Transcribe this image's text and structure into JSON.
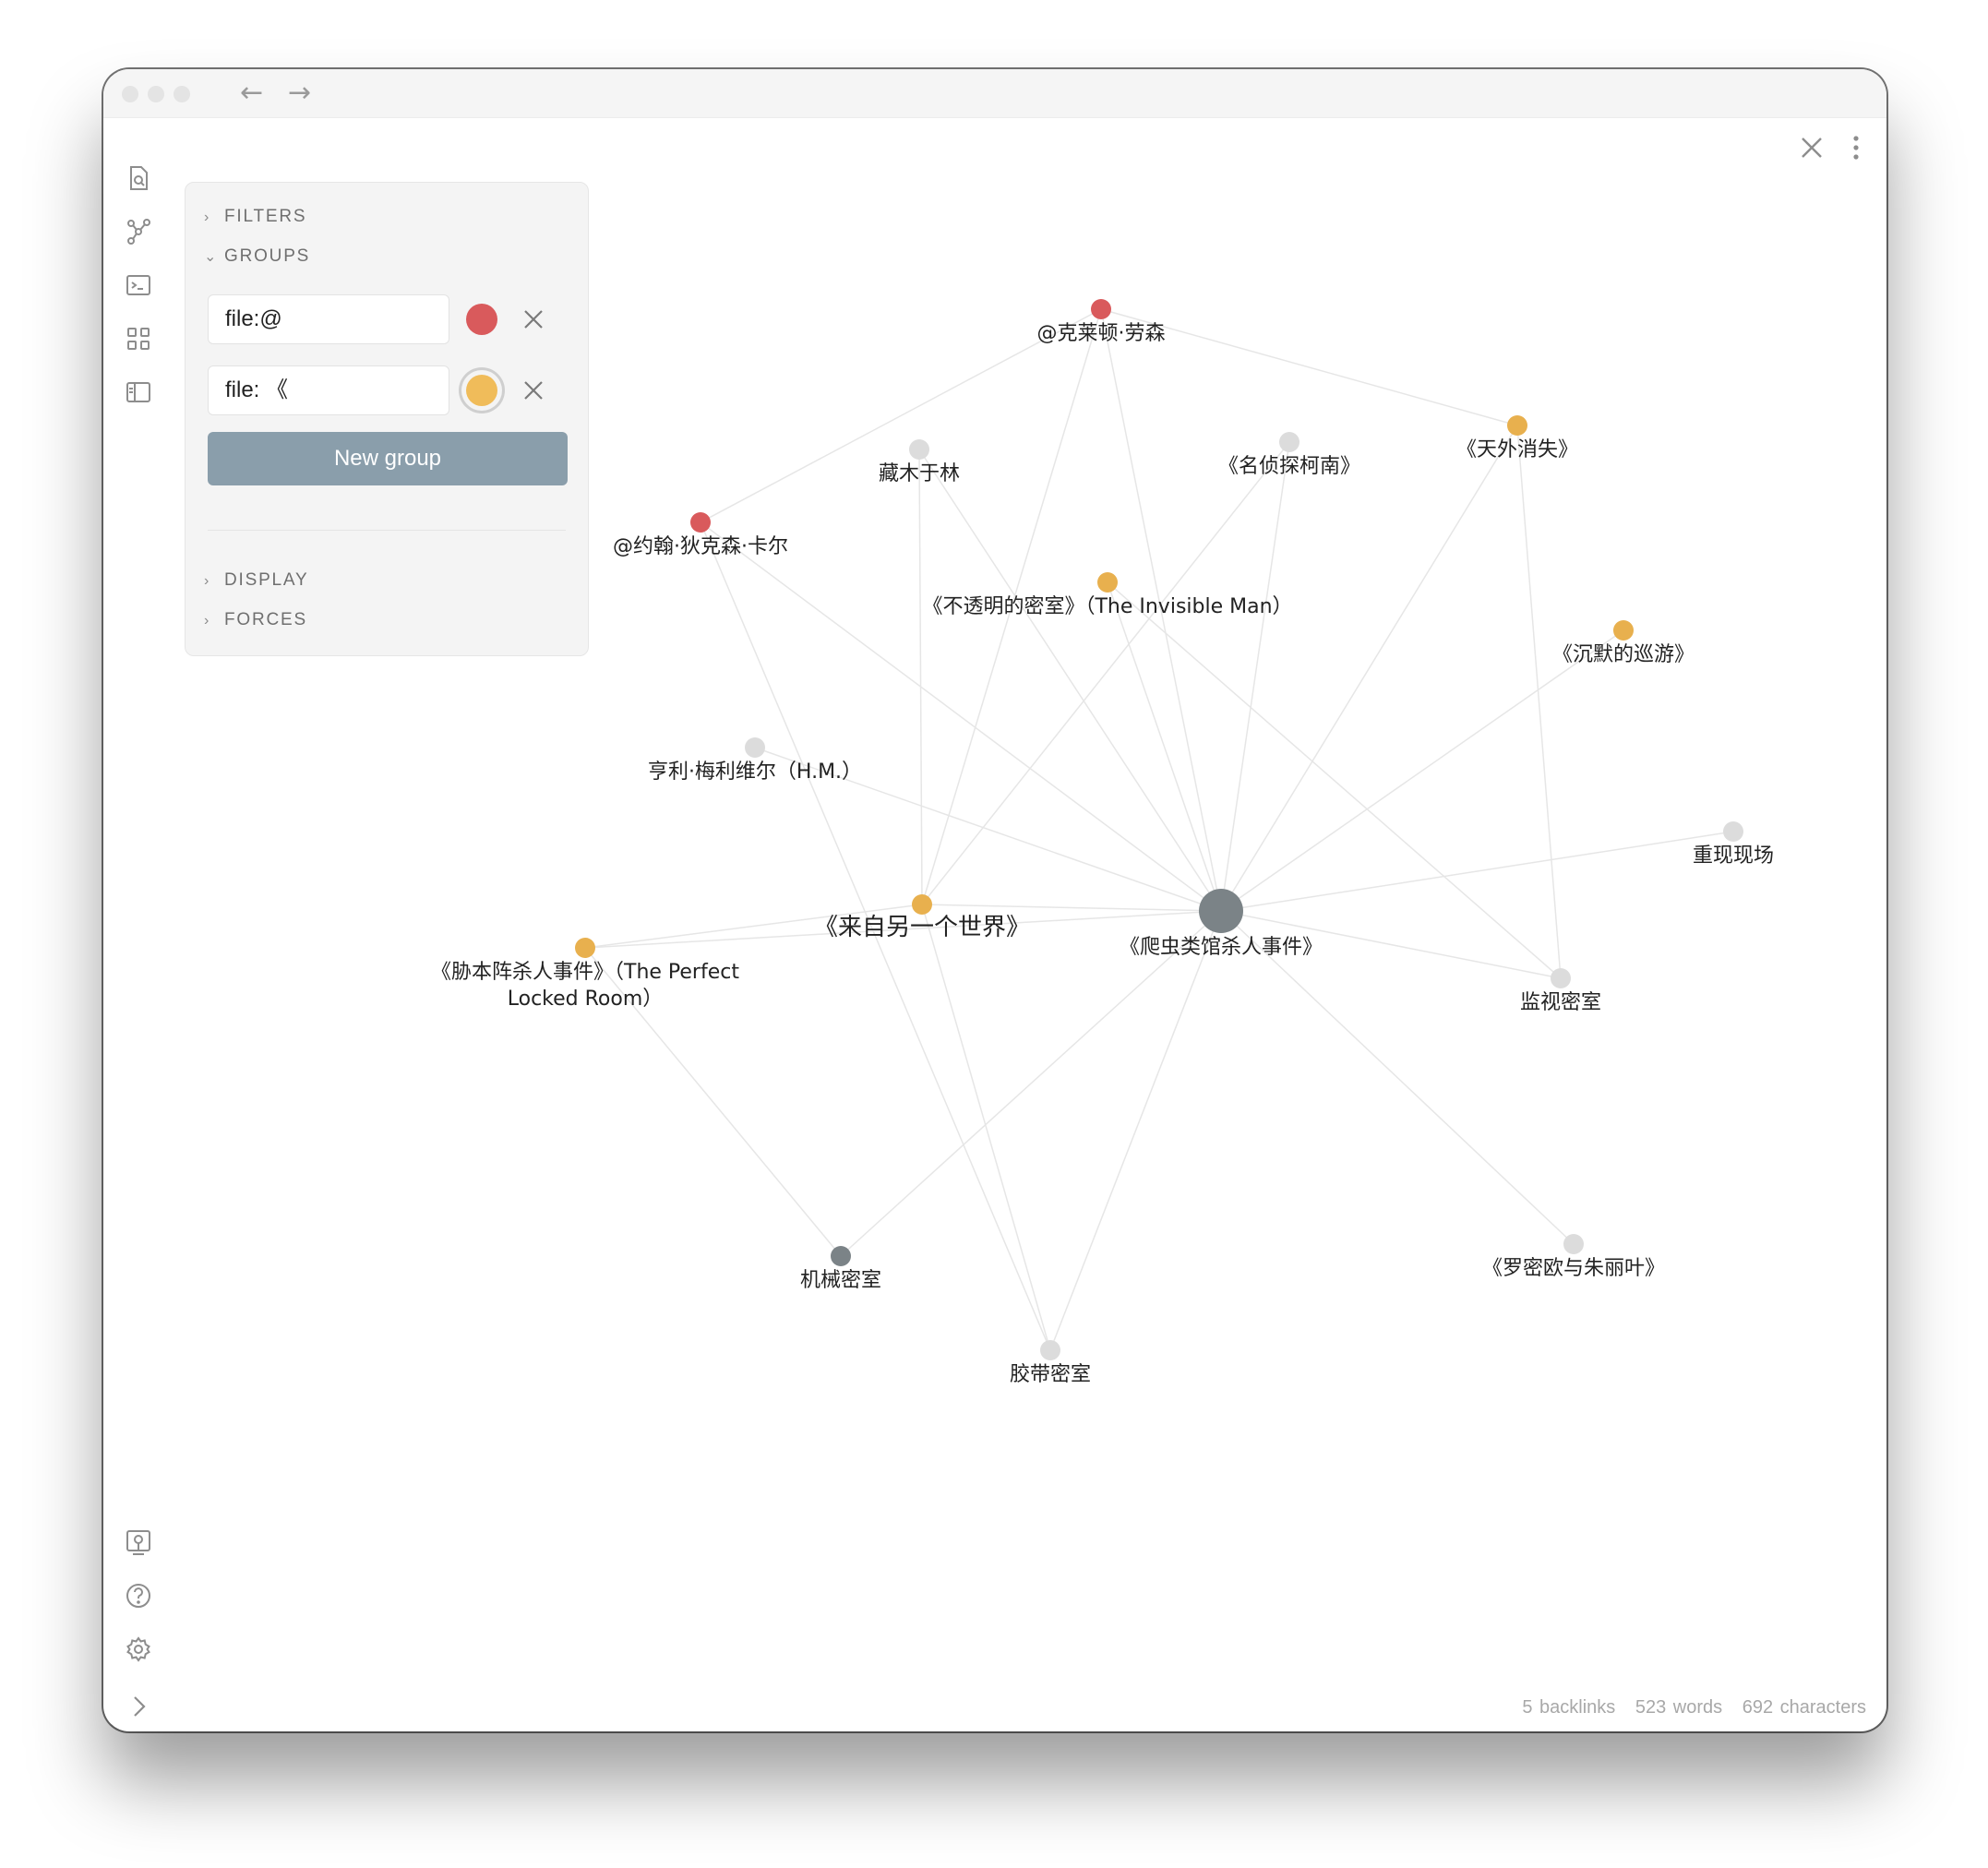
{
  "window": {
    "nav_back": "←",
    "nav_forward": "→"
  },
  "ribbon": {
    "top_icons": [
      "search-file-icon",
      "graph-icon",
      "terminal-icon",
      "blocks-icon",
      "sidebar-layout-icon"
    ],
    "bottom_icons": [
      "vault-icon",
      "help-icon",
      "settings-icon",
      "expand-icon"
    ]
  },
  "panel": {
    "filters_label": "FILTERS",
    "groups_label": "GROUPS",
    "display_label": "DISPLAY",
    "forces_label": "FORCES",
    "groups": [
      {
        "query": "file:@",
        "color": "#d95a5c"
      },
      {
        "query": "file: 《",
        "color": "#f0bc5a"
      }
    ],
    "new_group_label": "New group"
  },
  "graph": {
    "nodes": [
      {
        "id": "n1",
        "label": "@克莱顿·劳森",
        "color": "#d95a5c"
      },
      {
        "id": "n2",
        "label": "藏木于林",
        "color": "#dcdcdc"
      },
      {
        "id": "n3",
        "label": "《名侦探柯南》",
        "color": "#dcdcdc"
      },
      {
        "id": "n4",
        "label": "《天外消失》",
        "color": "#e8b04e"
      },
      {
        "id": "n5",
        "label": "@约翰·狄克森·卡尔",
        "color": "#d95a5c"
      },
      {
        "id": "n6",
        "label": "《不透明的密室》（The Invisible Man）",
        "color": "#e8b04e"
      },
      {
        "id": "n7",
        "label": "《沉默的巡游》",
        "color": "#e8b04e"
      },
      {
        "id": "n8",
        "label": "亨利·梅利维尔（H.M.）",
        "color": "#dcdcdc"
      },
      {
        "id": "n9",
        "label": "重现现场",
        "color": "#dcdcdc"
      },
      {
        "id": "n10",
        "label": "《来自另一个世界》",
        "color": "#e8b04e"
      },
      {
        "id": "n11",
        "label": "《爬虫类馆杀人事件》",
        "color": "#7b8387"
      },
      {
        "id": "n12",
        "label": "《胁本阵杀人事件》（The Perfect",
        "label2": "Locked Room）",
        "color": "#e8b04e"
      },
      {
        "id": "n13",
        "label": "监视密室",
        "color": "#dcdcdc"
      },
      {
        "id": "n14",
        "label": "机械密室",
        "color": "#7b8387"
      },
      {
        "id": "n15",
        "label": "《罗密欧与朱丽叶》",
        "color": "#dcdcdc"
      },
      {
        "id": "n16",
        "label": "胶带密室",
        "color": "#dcdcdc"
      }
    ],
    "edges": [
      [
        "n1",
        "n4"
      ],
      [
        "n1",
        "n5"
      ],
      [
        "n1",
        "n10"
      ],
      [
        "n1",
        "n11"
      ],
      [
        "n2",
        "n10"
      ],
      [
        "n2",
        "n11"
      ],
      [
        "n3",
        "n10"
      ],
      [
        "n3",
        "n11"
      ],
      [
        "n4",
        "n11"
      ],
      [
        "n4",
        "n13"
      ],
      [
        "n5",
        "n11"
      ],
      [
        "n5",
        "n16"
      ],
      [
        "n6",
        "n11"
      ],
      [
        "n6",
        "n13"
      ],
      [
        "n7",
        "n11"
      ],
      [
        "n8",
        "n11"
      ],
      [
        "n9",
        "n11"
      ],
      [
        "n10",
        "n11"
      ],
      [
        "n10",
        "n12"
      ],
      [
        "n10",
        "n16"
      ],
      [
        "n11",
        "n12"
      ],
      [
        "n11",
        "n13"
      ],
      [
        "n11",
        "n14"
      ],
      [
        "n11",
        "n15"
      ],
      [
        "n11",
        "n16"
      ],
      [
        "n12",
        "n14"
      ]
    ]
  },
  "status": {
    "backlinks": "5 backlinks",
    "words": "523 words",
    "characters": "692 characters"
  }
}
